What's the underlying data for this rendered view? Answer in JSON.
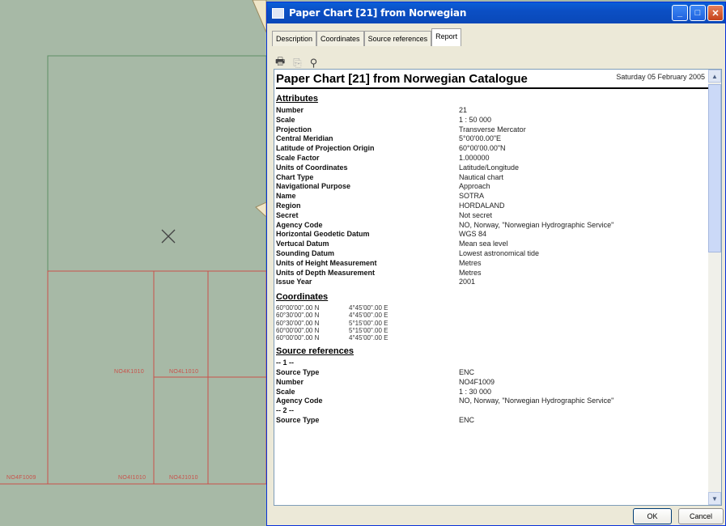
{
  "window": {
    "title": "Paper Chart [21] from Norwegian"
  },
  "tabs": [
    "Description",
    "Coordinates",
    "Source references",
    "Report"
  ],
  "active_tab": "Report",
  "report": {
    "title": "Paper Chart [21] from Norwegian Catalogue",
    "date": "Saturday 05 February 2005",
    "attributes_heading": "Attributes",
    "attributes": [
      {
        "k": "Number",
        "v": "21"
      },
      {
        "k": "Scale",
        "v": "1 : 50 000"
      },
      {
        "k": "Projection",
        "v": "Transverse Mercator"
      },
      {
        "k": "Central Meridian",
        "v": "5°00'00.00\"E"
      },
      {
        "k": "Latitude of Projection Origin",
        "v": "60°00'00.00\"N"
      },
      {
        "k": "Scale Factor",
        "v": "1.000000"
      },
      {
        "k": "Units of Coordinates",
        "v": "Latitude/Longitude"
      },
      {
        "k": "Chart Type",
        "v": "Nautical chart"
      },
      {
        "k": "Navigational Purpose",
        "v": "Approach"
      },
      {
        "k": "Name",
        "v": "SOTRA"
      },
      {
        "k": "Region",
        "v": "HORDALAND"
      },
      {
        "k": "Secret",
        "v": "Not secret"
      },
      {
        "k": "Agency Code",
        "v": "NO, Norway, \"Norwegian Hydrographic Service\""
      },
      {
        "k": "Horizontal Geodetic Datum",
        "v": "WGS 84"
      },
      {
        "k": "Vertucal Datum",
        "v": "Mean sea level"
      },
      {
        "k": "Sounding Datum",
        "v": "Lowest astronomical tide"
      },
      {
        "k": "Units of Height Measurement",
        "v": "Metres"
      },
      {
        "k": "Units of Depth Measurement",
        "v": "Metres"
      },
      {
        "k": "Issue Year",
        "v": "2001"
      }
    ],
    "coordinates_heading": "Coordinates",
    "coordinates": [
      {
        "lat": "60°00'00\".00 N",
        "lon": "4°45'00\".00 E"
      },
      {
        "lat": "60°30'00\".00 N",
        "lon": "4°45'00\".00 E"
      },
      {
        "lat": "60°30'00\".00 N",
        "lon": "5°15'00\".00 E"
      },
      {
        "lat": "60°00'00\".00 N",
        "lon": "5°15'00\".00 E"
      },
      {
        "lat": "60°00'00\".00 N",
        "lon": "4°45'00\".00 E"
      }
    ],
    "sources_heading": "Source references",
    "sources": [
      {
        "sep": "-- 1 --"
      },
      {
        "k": "Source Type",
        "v": "ENC"
      },
      {
        "k": "Number",
        "v": "NO4F1009"
      },
      {
        "k": "Scale",
        "v": "1 : 30 000"
      },
      {
        "k": "Agency Code",
        "v": "NO, Norway, \"Norwegian Hydrographic Service\""
      },
      {
        "sep": "-- 2 --"
      },
      {
        "k": "Source Type",
        "v": "ENC"
      }
    ]
  },
  "buttons": {
    "ok": "OK",
    "cancel": "Cancel"
  },
  "map_labels": [
    {
      "id": "NO4K1010",
      "text": "NO4K1010"
    },
    {
      "id": "NO4L1010",
      "text": "NO4L1010"
    },
    {
      "id": "NO4F1009",
      "text": "NO4F1009"
    },
    {
      "id": "NO4I1010",
      "text": "NO4I1010"
    },
    {
      "id": "NO4J1010",
      "text": "NO4J1010"
    }
  ],
  "colors": {
    "map_bg": "#a7b9a6",
    "chart_outline": "#c9514a",
    "title_bar": "#0a5fd8"
  }
}
